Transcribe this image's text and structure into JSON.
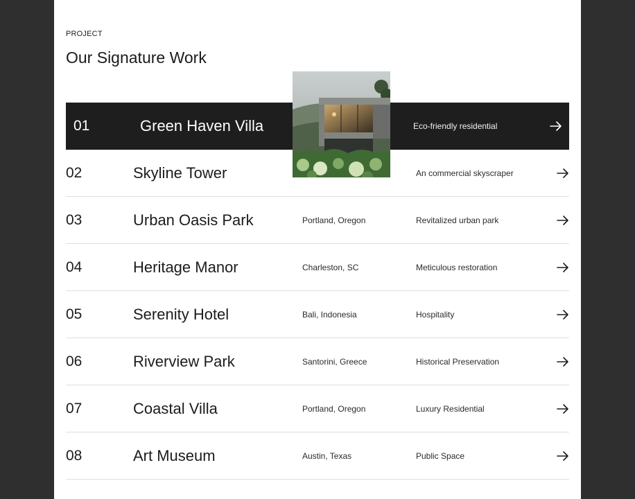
{
  "section": {
    "eyebrow": "PROJECT",
    "title": "Our Signature Work"
  },
  "projects": [
    {
      "num": "01",
      "name": "Green Haven Villa",
      "location": "",
      "description": "Eco-friendly residential",
      "active": true
    },
    {
      "num": "02",
      "name": "Skyline Tower",
      "location": "",
      "description": "An commercial skyscraper"
    },
    {
      "num": "03",
      "name": "Urban Oasis Park",
      "location": "Portland, Oregon",
      "description": "Revitalized urban park"
    },
    {
      "num": "04",
      "name": "Heritage Manor",
      "location": "Charleston, SC",
      "description": "Meticulous restoration"
    },
    {
      "num": "05",
      "name": "Serenity Hotel",
      "location": "Bali, Indonesia",
      "description": "Hospitality"
    },
    {
      "num": "06",
      "name": "Riverview Park",
      "location": "Santorini, Greece",
      "description": "Historical Preservation"
    },
    {
      "num": "07",
      "name": "Coastal Villa",
      "location": "Portland, Oregon",
      "description": "Luxury Residential"
    },
    {
      "num": "08",
      "name": "Art Museum",
      "location": "Austin, Texas",
      "description": "Public Space"
    }
  ],
  "icons": {
    "row_action": "arrow-right-icon",
    "preview": "villa-preview-image"
  },
  "colors": {
    "active_row": "#1e1e1e",
    "page_bg": "#ffffff",
    "frame_bg": "#2f2f2f",
    "divider": "#dedede"
  }
}
